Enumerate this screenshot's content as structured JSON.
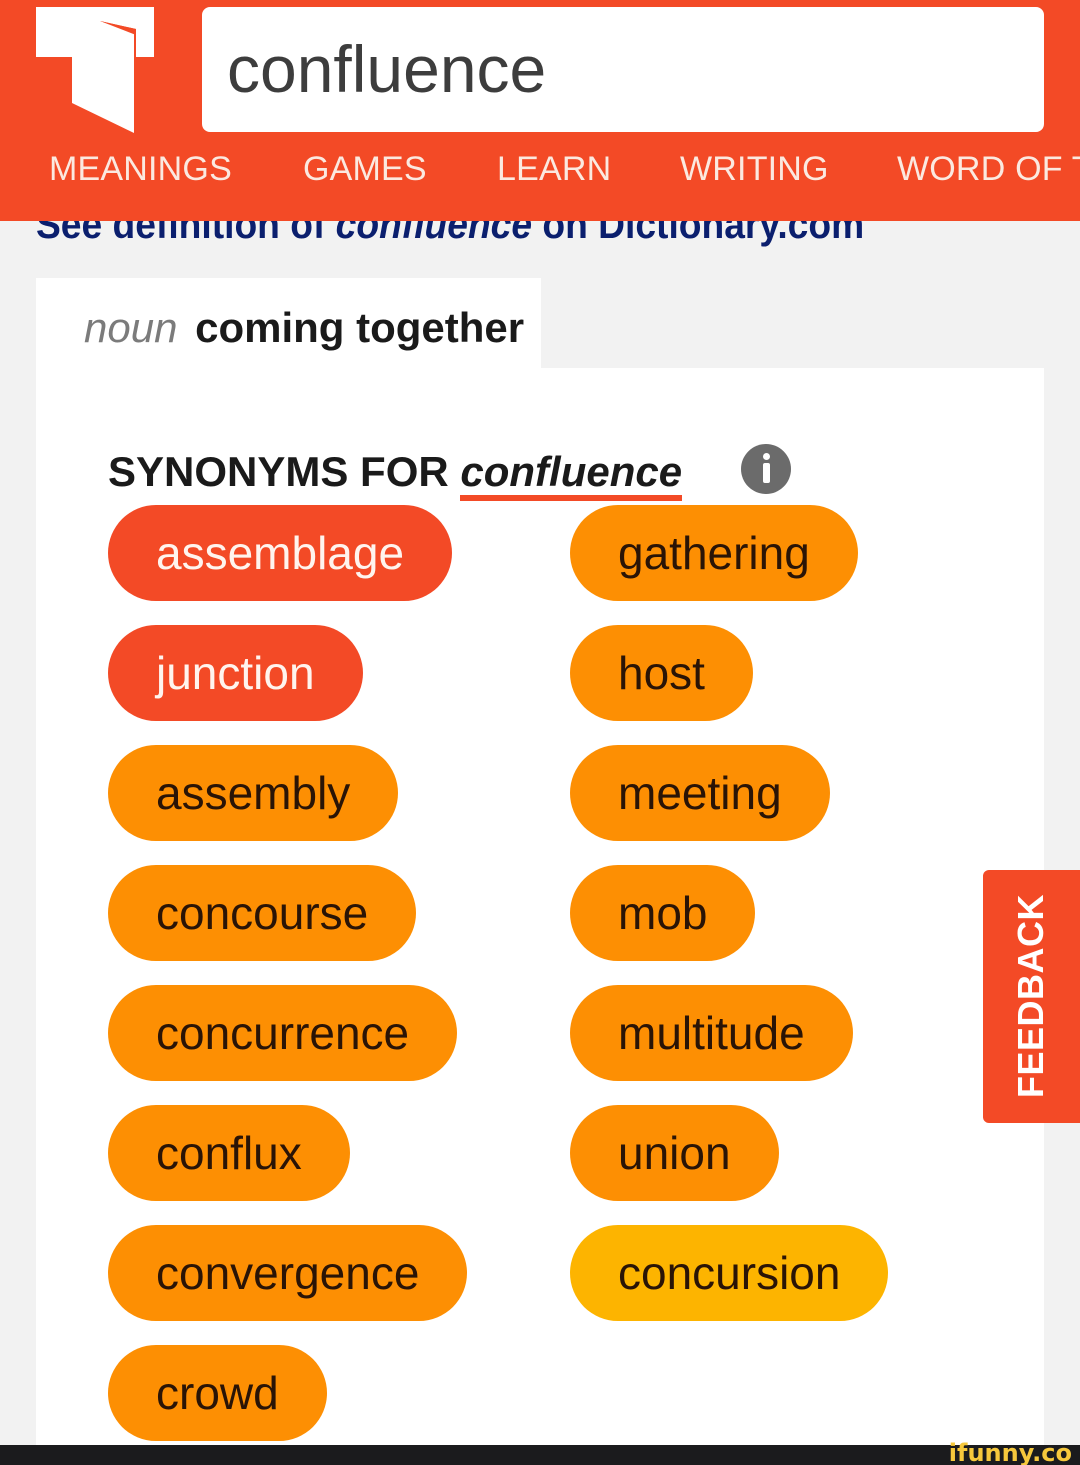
{
  "header": {
    "search": {
      "value": "confluence",
      "placeholder": ""
    },
    "nav": [
      {
        "label": "MEANINGS"
      },
      {
        "label": "GAMES"
      },
      {
        "label": "LEARN"
      },
      {
        "label": "WRITING"
      },
      {
        "label": "WORD OF T"
      }
    ],
    "brand_color": "#f34a26"
  },
  "definition_link": {
    "prefix": "See definition of ",
    "word": "confluence",
    "suffix": " on Dictionary.com"
  },
  "sense": {
    "part_of_speech": "noun",
    "definition": "coming together"
  },
  "synonyms": {
    "title_prefix": "SYNONYMS FOR ",
    "word": "confluence",
    "left_column": [
      {
        "label": "assemblage",
        "relevance": "strong"
      },
      {
        "label": "junction",
        "relevance": "strong"
      },
      {
        "label": "assembly",
        "relevance": "medium"
      },
      {
        "label": "concourse",
        "relevance": "medium"
      },
      {
        "label": "concurrence",
        "relevance": "medium"
      },
      {
        "label": "conflux",
        "relevance": "medium"
      },
      {
        "label": "convergence",
        "relevance": "medium"
      },
      {
        "label": "crowd",
        "relevance": "medium"
      }
    ],
    "right_column": [
      {
        "label": "gathering",
        "relevance": "medium"
      },
      {
        "label": "host",
        "relevance": "medium"
      },
      {
        "label": "meeting",
        "relevance": "medium"
      },
      {
        "label": "mob",
        "relevance": "medium"
      },
      {
        "label": "multitude",
        "relevance": "medium"
      },
      {
        "label": "union",
        "relevance": "medium"
      },
      {
        "label": "concursion",
        "relevance": "weak"
      }
    ],
    "relevance_colors": {
      "strong": "#f34a26",
      "medium": "#fd8f03",
      "weak": "#fdb400"
    }
  },
  "feedback": {
    "label": "FEEDBACK"
  },
  "watermark": {
    "text": "ifunny.co"
  }
}
